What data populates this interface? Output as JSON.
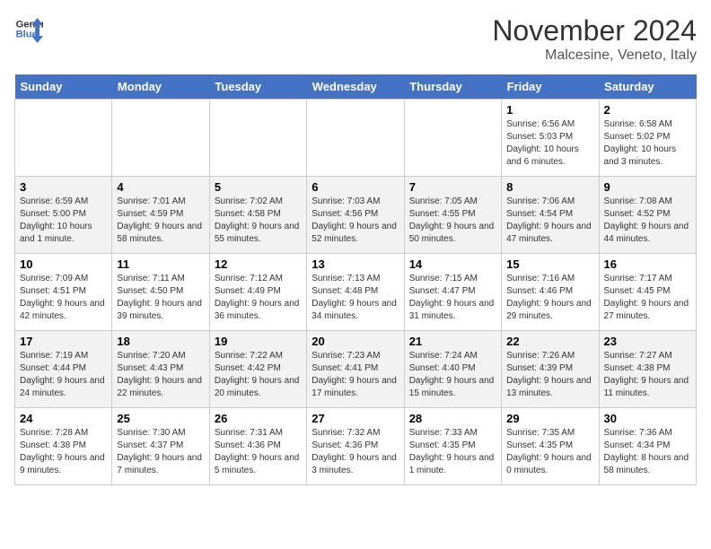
{
  "header": {
    "logo_line1": "General",
    "logo_line2": "Blue",
    "month": "November 2024",
    "location": "Malcesine, Veneto, Italy"
  },
  "weekdays": [
    "Sunday",
    "Monday",
    "Tuesday",
    "Wednesday",
    "Thursday",
    "Friday",
    "Saturday"
  ],
  "weeks": [
    [
      {
        "day": "",
        "info": ""
      },
      {
        "day": "",
        "info": ""
      },
      {
        "day": "",
        "info": ""
      },
      {
        "day": "",
        "info": ""
      },
      {
        "day": "",
        "info": ""
      },
      {
        "day": "1",
        "info": "Sunrise: 6:56 AM\nSunset: 5:03 PM\nDaylight: 10 hours and 6 minutes."
      },
      {
        "day": "2",
        "info": "Sunrise: 6:58 AM\nSunset: 5:02 PM\nDaylight: 10 hours and 3 minutes."
      }
    ],
    [
      {
        "day": "3",
        "info": "Sunrise: 6:59 AM\nSunset: 5:00 PM\nDaylight: 10 hours and 1 minute."
      },
      {
        "day": "4",
        "info": "Sunrise: 7:01 AM\nSunset: 4:59 PM\nDaylight: 9 hours and 58 minutes."
      },
      {
        "day": "5",
        "info": "Sunrise: 7:02 AM\nSunset: 4:58 PM\nDaylight: 9 hours and 55 minutes."
      },
      {
        "day": "6",
        "info": "Sunrise: 7:03 AM\nSunset: 4:56 PM\nDaylight: 9 hours and 52 minutes."
      },
      {
        "day": "7",
        "info": "Sunrise: 7:05 AM\nSunset: 4:55 PM\nDaylight: 9 hours and 50 minutes."
      },
      {
        "day": "8",
        "info": "Sunrise: 7:06 AM\nSunset: 4:54 PM\nDaylight: 9 hours and 47 minutes."
      },
      {
        "day": "9",
        "info": "Sunrise: 7:08 AM\nSunset: 4:52 PM\nDaylight: 9 hours and 44 minutes."
      }
    ],
    [
      {
        "day": "10",
        "info": "Sunrise: 7:09 AM\nSunset: 4:51 PM\nDaylight: 9 hours and 42 minutes."
      },
      {
        "day": "11",
        "info": "Sunrise: 7:11 AM\nSunset: 4:50 PM\nDaylight: 9 hours and 39 minutes."
      },
      {
        "day": "12",
        "info": "Sunrise: 7:12 AM\nSunset: 4:49 PM\nDaylight: 9 hours and 36 minutes."
      },
      {
        "day": "13",
        "info": "Sunrise: 7:13 AM\nSunset: 4:48 PM\nDaylight: 9 hours and 34 minutes."
      },
      {
        "day": "14",
        "info": "Sunrise: 7:15 AM\nSunset: 4:47 PM\nDaylight: 9 hours and 31 minutes."
      },
      {
        "day": "15",
        "info": "Sunrise: 7:16 AM\nSunset: 4:46 PM\nDaylight: 9 hours and 29 minutes."
      },
      {
        "day": "16",
        "info": "Sunrise: 7:17 AM\nSunset: 4:45 PM\nDaylight: 9 hours and 27 minutes."
      }
    ],
    [
      {
        "day": "17",
        "info": "Sunrise: 7:19 AM\nSunset: 4:44 PM\nDaylight: 9 hours and 24 minutes."
      },
      {
        "day": "18",
        "info": "Sunrise: 7:20 AM\nSunset: 4:43 PM\nDaylight: 9 hours and 22 minutes."
      },
      {
        "day": "19",
        "info": "Sunrise: 7:22 AM\nSunset: 4:42 PM\nDaylight: 9 hours and 20 minutes."
      },
      {
        "day": "20",
        "info": "Sunrise: 7:23 AM\nSunset: 4:41 PM\nDaylight: 9 hours and 17 minutes."
      },
      {
        "day": "21",
        "info": "Sunrise: 7:24 AM\nSunset: 4:40 PM\nDaylight: 9 hours and 15 minutes."
      },
      {
        "day": "22",
        "info": "Sunrise: 7:26 AM\nSunset: 4:39 PM\nDaylight: 9 hours and 13 minutes."
      },
      {
        "day": "23",
        "info": "Sunrise: 7:27 AM\nSunset: 4:38 PM\nDaylight: 9 hours and 11 minutes."
      }
    ],
    [
      {
        "day": "24",
        "info": "Sunrise: 7:28 AM\nSunset: 4:38 PM\nDaylight: 9 hours and 9 minutes."
      },
      {
        "day": "25",
        "info": "Sunrise: 7:30 AM\nSunset: 4:37 PM\nDaylight: 9 hours and 7 minutes."
      },
      {
        "day": "26",
        "info": "Sunrise: 7:31 AM\nSunset: 4:36 PM\nDaylight: 9 hours and 5 minutes."
      },
      {
        "day": "27",
        "info": "Sunrise: 7:32 AM\nSunset: 4:36 PM\nDaylight: 9 hours and 3 minutes."
      },
      {
        "day": "28",
        "info": "Sunrise: 7:33 AM\nSunset: 4:35 PM\nDaylight: 9 hours and 1 minute."
      },
      {
        "day": "29",
        "info": "Sunrise: 7:35 AM\nSunset: 4:35 PM\nDaylight: 9 hours and 0 minutes."
      },
      {
        "day": "30",
        "info": "Sunrise: 7:36 AM\nSunset: 4:34 PM\nDaylight: 8 hours and 58 minutes."
      }
    ]
  ]
}
